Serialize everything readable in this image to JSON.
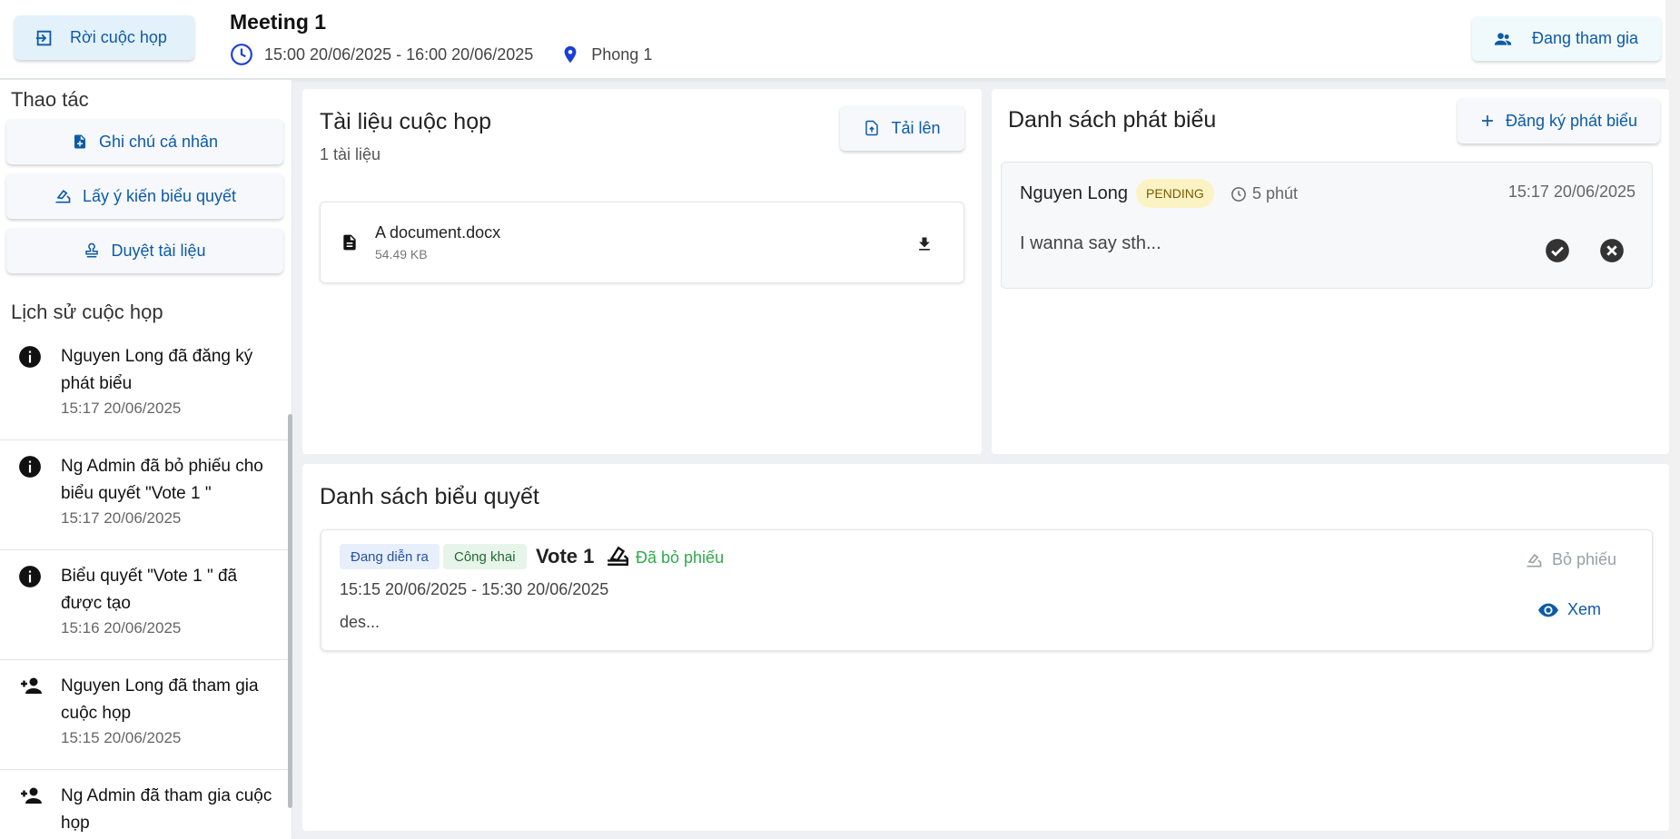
{
  "header": {
    "leave_label": "Rời cuộc họp",
    "title": "Meeting 1",
    "time_range": "15:00 20/06/2025 - 16:00 20/06/2025",
    "location": "Phong 1",
    "joined_label": "Đang tham gia"
  },
  "sidebar": {
    "actions_title": "Thao tác",
    "actions": [
      {
        "label": "Ghi chú cá nhân",
        "icon": "note-add-icon"
      },
      {
        "label": "Lấy ý kiến biểu quyết",
        "icon": "vote-icon"
      },
      {
        "label": "Duyệt tài liệu",
        "icon": "stamp-icon"
      }
    ],
    "history_title": "Lịch sử cuộc họp",
    "history": [
      {
        "text": "Nguyen Long đã đăng ký phát biểu",
        "time": "15:17 20/06/2025",
        "icon": "info-icon"
      },
      {
        "text": "Ng Admin đã bỏ phiếu cho biểu quyết \"Vote 1 \"",
        "time": "15:17 20/06/2025",
        "icon": "info-icon"
      },
      {
        "text": "Biểu quyết \"Vote 1 \" đã được tạo",
        "time": "15:16 20/06/2025",
        "icon": "info-icon"
      },
      {
        "text": "Nguyen Long đã tham gia cuộc họp",
        "time": "15:15 20/06/2025",
        "icon": "person-add-icon"
      },
      {
        "text": "Ng Admin đã tham gia cuộc họp",
        "time": "",
        "icon": "person-add-icon"
      }
    ]
  },
  "documents": {
    "title": "Tài liệu cuộc họp",
    "count": "1 tài liệu",
    "upload_label": "Tải lên",
    "items": [
      {
        "name": "A document.docx",
        "size": "54.49 KB"
      }
    ]
  },
  "speeches": {
    "title": "Danh sách phát biểu",
    "register_label": "Đăng ký phát biểu",
    "items": [
      {
        "name": "Nguyen Long",
        "status": "PENDING",
        "duration": "5 phút",
        "time": "15:17 20/06/2025",
        "content": "I wanna say sth..."
      }
    ]
  },
  "votes": {
    "title": "Danh sách biểu quyết",
    "items": [
      {
        "status": "Đang diễn ra",
        "visibility": "Công khai",
        "title": "Vote 1",
        "voted": "Đã bỏ phiếu",
        "time": "15:15 20/06/2025 - 15:30 20/06/2025",
        "description": "des...",
        "cast_label": "Bỏ phiếu",
        "view_label": "Xem"
      }
    ]
  },
  "colors": {
    "accent": "#0d5aa7",
    "pending_bg": "#fcf3c4",
    "voted_green": "#2eaa4a"
  }
}
